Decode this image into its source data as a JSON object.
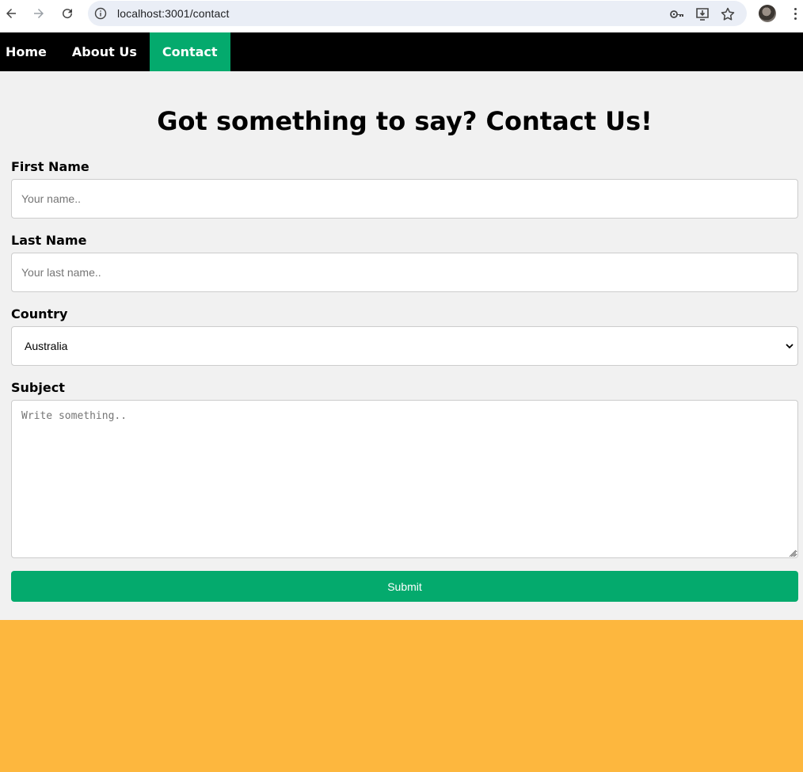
{
  "browser": {
    "url": "localhost:3001/contact",
    "icons": {
      "back": "arrow-left-icon",
      "forward": "arrow-right-icon",
      "reload": "reload-icon",
      "site_info": "info-icon",
      "password": "key-icon",
      "install": "install-app-icon",
      "bookmark": "star-icon",
      "profile": "avatar",
      "menu": "more-vert-icon"
    }
  },
  "nav": {
    "items": [
      {
        "label": "Home",
        "active": false
      },
      {
        "label": "About Us",
        "active": false
      },
      {
        "label": "Contact",
        "active": true
      }
    ],
    "background": "#000000",
    "active_color": "#04aa6d"
  },
  "form": {
    "title": "Got something to say? Contact Us!",
    "first_name": {
      "label": "First Name",
      "placeholder": "Your name..",
      "value": ""
    },
    "last_name": {
      "label": "Last Name",
      "placeholder": "Your last name..",
      "value": ""
    },
    "country": {
      "label": "Country",
      "selected": "Australia"
    },
    "subject": {
      "label": "Subject",
      "placeholder": "Write something..",
      "value": ""
    },
    "submit_label": "Submit",
    "button_color": "#04aa6d"
  },
  "colors": {
    "page_bg": "#f1f1f1",
    "footer_band": "#fdb73e"
  }
}
